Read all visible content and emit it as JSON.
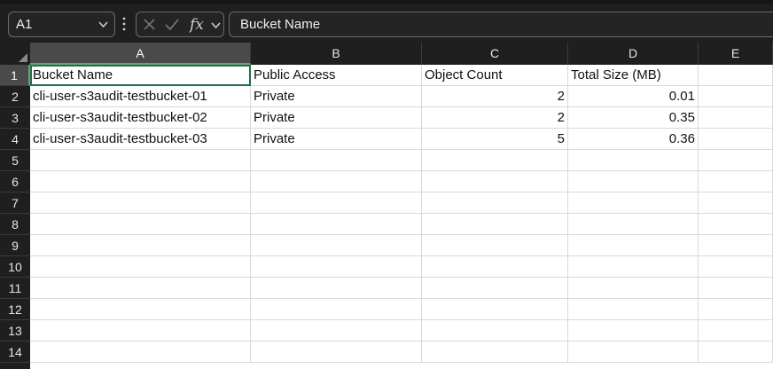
{
  "formula_bar": {
    "name_box": "A1",
    "formula": "Bucket Name",
    "cancel_icon": "close-icon",
    "enter_icon": "check-icon",
    "function_icon": "fx-icon"
  },
  "columns": [
    "A",
    "B",
    "C",
    "D",
    "E"
  ],
  "row_numbers": [
    "1",
    "2",
    "3",
    "4",
    "5",
    "6",
    "7",
    "8",
    "9",
    "10",
    "11",
    "12",
    "13",
    "14"
  ],
  "sheet": {
    "headers": [
      "Bucket Name",
      "Public Access",
      "Object Count",
      "Total Size (MB)"
    ],
    "rows": [
      [
        "cli-user-s3audit-testbucket-01",
        "Private",
        "2",
        "0.01"
      ],
      [
        "cli-user-s3audit-testbucket-02",
        "Private",
        "2",
        "0.35"
      ],
      [
        "cli-user-s3audit-testbucket-03",
        "Private",
        "5",
        "0.36"
      ]
    ]
  },
  "selected_cell": "A1",
  "colors": {
    "chrome_bg": "#1f1f1f",
    "selection_green": "#1e7145",
    "gridline": "#d9d9d9"
  }
}
